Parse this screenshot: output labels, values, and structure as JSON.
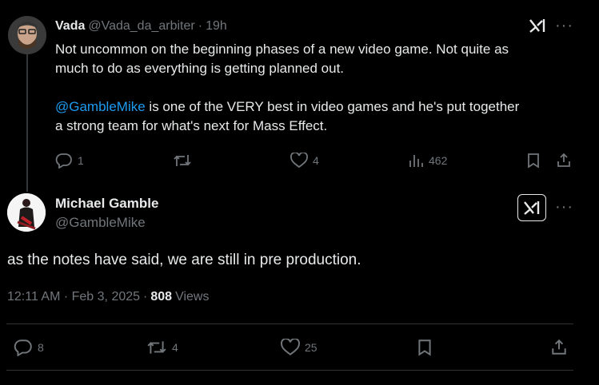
{
  "reply_tweet": {
    "author_name": "Vada",
    "handle": "@Vada_da_arbiter",
    "dot": "·",
    "time": "19h",
    "text_line1": "Not uncommon on the beginning phases of a new video game.  Not quite as",
    "text_line2": "much to do as everything is getting planned out.",
    "mention": "@GambleMike",
    "text_line3_rest": " is one of the VERY best in video games and he's put together",
    "text_line4": "a strong team for what's next for Mass Effect.",
    "replies": "1",
    "reposts": "",
    "likes": "4",
    "views": "462"
  },
  "main_tweet": {
    "author_name": "Michael Gamble",
    "handle": "@GambleMike",
    "text": "as the notes have said, we are still in pre production.",
    "timestamp": "12:11 AM · Feb 3, 2025",
    "dot": "·",
    "views_count": "808",
    "views_label": "Views",
    "replies": "8",
    "reposts": "4",
    "likes": "25"
  },
  "colors": {
    "background": "#000000",
    "text": "#e7e9ea",
    "muted": "#71767b",
    "link": "#1d9bf0",
    "divider": "#2f3336"
  },
  "icons": [
    "grok-icon",
    "more-icon",
    "reply-icon",
    "repost-icon",
    "like-icon",
    "views-icon",
    "bookmark-icon",
    "share-icon"
  ]
}
